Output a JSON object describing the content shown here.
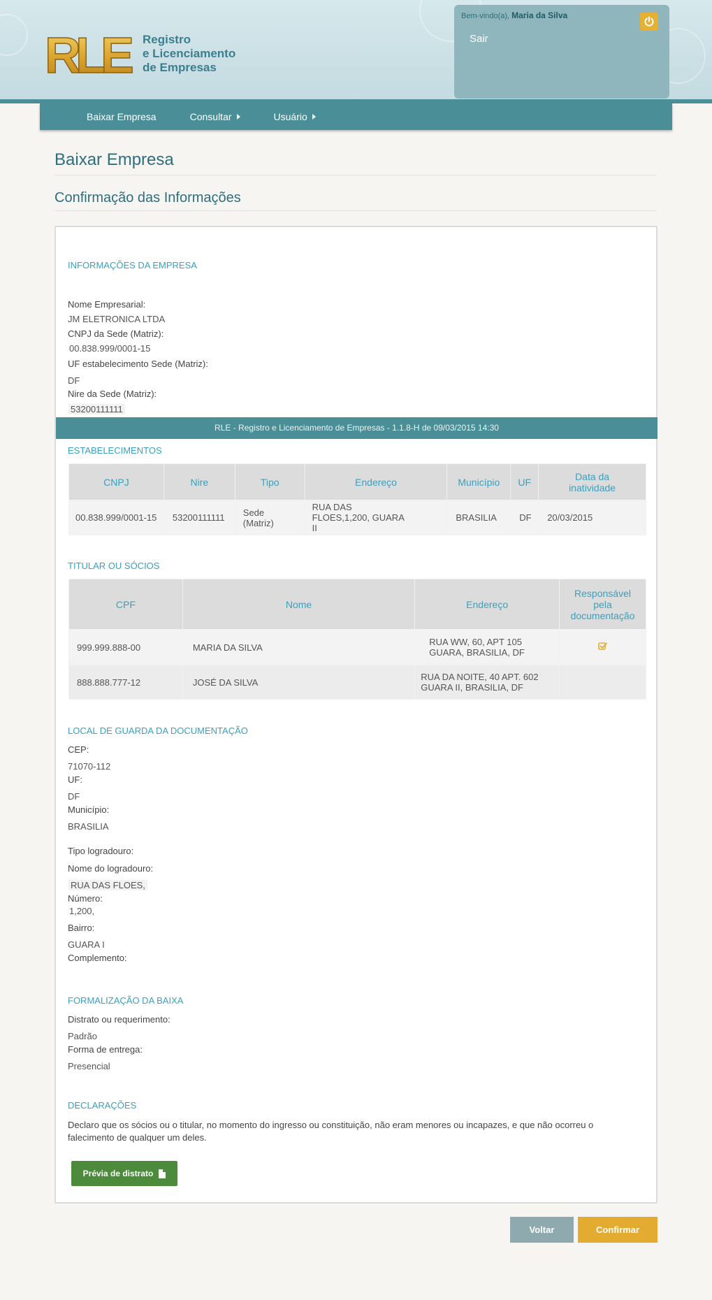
{
  "header": {
    "logo_text": "RLE",
    "logo_subtitle_lines": [
      "Registro",
      "e Licenciamento",
      "de Empresas"
    ],
    "welcome_prefix": "Bem-vindo(a),",
    "user_name": "Maria da Silva",
    "logout_label": "Sair",
    "logout_icon": "power-icon"
  },
  "nav": {
    "items": [
      {
        "label": "Baixar Empresa",
        "has_submenu": false
      },
      {
        "label": "Consultar",
        "has_submenu": true
      },
      {
        "label": "Usuário",
        "has_submenu": true
      }
    ]
  },
  "page": {
    "title": "Baixar Empresa",
    "subtitle": "Confirmação das Informações"
  },
  "empresa": {
    "heading": "INFORMAÇÕES DA EMPRESA",
    "nome_label": "Nome Empresarial:",
    "nome_value": "JM ELETRONICA LTDA",
    "cnpj_label": "CNPJ da Sede (Matriz):",
    "cnpj_value": "00.838.999/0001-15",
    "uf_label": "UF estabelecimento Sede (Matriz):",
    "uf_value": "DF",
    "nire_label": "Nire da Sede (Matriz):",
    "nire_value": "53200111111"
  },
  "footer_bar": "RLE - Registro e Licenciamento de Empresas - 1.1.8-H de 09/03/2015 14:30",
  "estabelecimentos": {
    "heading": "ESTABELECIMENTOS",
    "columns": [
      "CNPJ",
      "Nire",
      "Tipo",
      "Endereço",
      "Município",
      "UF",
      "Data da inatividade"
    ],
    "rows": [
      [
        "00.838.999/0001-15",
        "53200111111",
        "Sede (Matriz)",
        "RUA DAS FLOES,1,200, GUARA II",
        "BRASILIA",
        "DF",
        "20/03/2015"
      ]
    ]
  },
  "socios": {
    "heading": "TITULAR OU SÓCIOS",
    "columns": [
      "CPF",
      "Nome",
      "Endereço",
      "Responsável pela documentação"
    ],
    "rows": [
      {
        "cpf": "999.999.888-00",
        "nome": "MARIA DA SILVA",
        "endereco": "RUA WW, 60, APT 105 GUARA, BRASILIA, DF",
        "responsavel": true
      },
      {
        "cpf": "888.888.777-12",
        "nome": "JOSÉ DA SILVA",
        "endereco": "RUA DA NOITE, 40 APT. 602 GUARA II, BRASILIA, DF",
        "responsavel": false
      }
    ]
  },
  "local": {
    "heading": "LOCAL DE GUARDA DA DOCUMENTAÇÃO",
    "cep_label": "CEP:",
    "cep_value": "71070-112",
    "uf_label": "UF:",
    "uf_value": "DF",
    "municipio_label": "Município:",
    "municipio_value": "BRASILIA",
    "tipo_label": "Tipo logradouro:",
    "nome_log_label": "Nome do logradouro:",
    "nome_log_value": "RUA DAS FLOES,",
    "numero_label": "Número:",
    "numero_value": "1,200,",
    "bairro_label": "Bairro:",
    "bairro_value": "GUARA I",
    "complemento_label": "Complemento:"
  },
  "formalizacao": {
    "heading": "FORMALIZAÇÃO DA BAIXA",
    "distrato_label": "Distrato ou requerimento:",
    "distrato_value": "Padrão",
    "entrega_label": "Forma de entrega:",
    "entrega_value": "Presencial"
  },
  "declaracoes": {
    "heading": "DECLARAÇÕES",
    "text": "Declaro que os sócios ou o titular, no momento do ingresso ou constituição, não eram menores ou incapazes, e que não ocorreu o falecimento de qualquer um deles."
  },
  "buttons": {
    "previa": "Prévia de distrato",
    "voltar": "Voltar",
    "confirmar": "Confirmar"
  },
  "colors": {
    "brand_teal": "#4a8f98",
    "section_heading": "#3aa0bd",
    "accent_yellow": "#e3ac31",
    "button_green": "#4b8b3b"
  }
}
